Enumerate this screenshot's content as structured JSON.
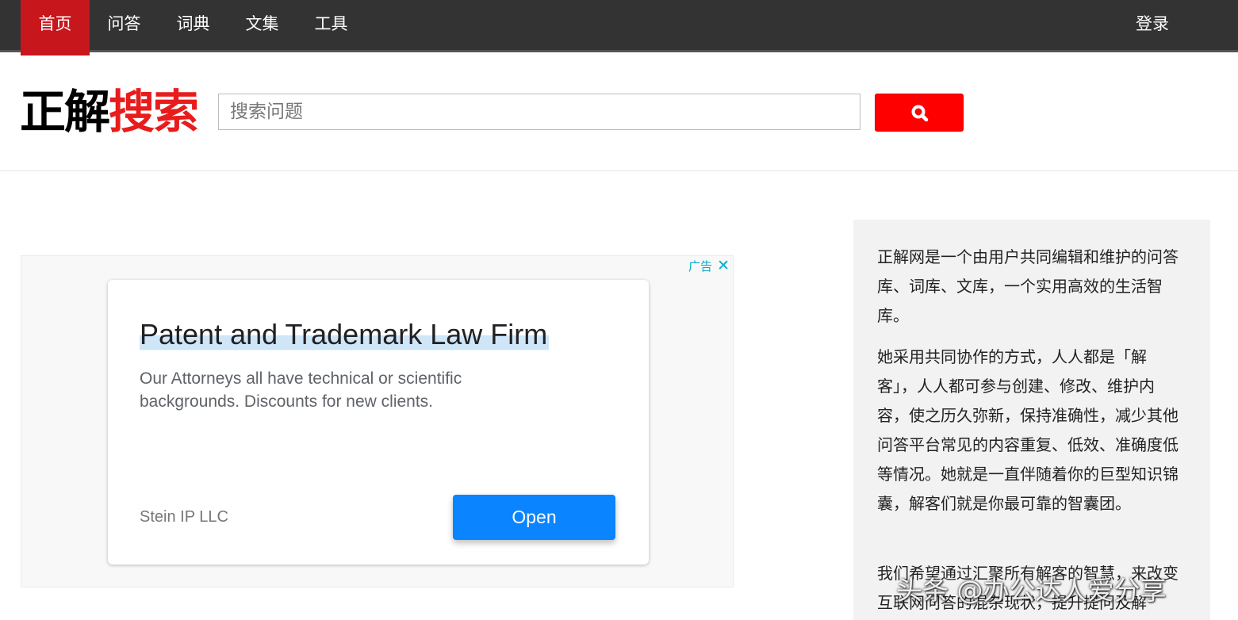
{
  "nav": {
    "items": [
      {
        "label": "首页",
        "active": true
      },
      {
        "label": "问答",
        "active": false
      },
      {
        "label": "词典",
        "active": false
      },
      {
        "label": "文集",
        "active": false
      },
      {
        "label": "工具",
        "active": false
      }
    ],
    "login_label": "登录"
  },
  "header": {
    "logo_black": "正解",
    "logo_red": "搜索",
    "search_placeholder": "搜索问题",
    "search_icon": "search-icon"
  },
  "ad": {
    "label": "广告",
    "close_glyph": "✕",
    "title": "Patent and Trademark Law Firm",
    "description": "Our Attorneys all have technical or scientific backgrounds. Discounts for new clients.",
    "advertiser": "Stein IP LLC",
    "cta": "Open"
  },
  "sidebar": {
    "paragraphs": [
      "正解网是一个由用户共同编辑和维护的问答库、词库、文库，一个实用高效的生活智库。",
      "她采用共同协作的方式，人人都是「解客」，人人都可参与创建、修改、维护内容，使之历久弥新，保持准确性，减少其他问答平台常见的内容重复、低效、准确度低等情况。她就是一直伴随着你的巨型知识锦囊，解客们就是你最可靠的智囊团。",
      "我们希望通过汇聚所有解客的智慧，来改变互联网问答的混杂现状，提升提问及解"
    ]
  },
  "watermark": "头条 @办公达人爱分享",
  "colors": {
    "nav_bg": "#333333",
    "nav_active": "#c8161d",
    "brand_red": "#e81c1c",
    "search_button": "#ff0000",
    "ad_cta": "#0a84ff",
    "sidebar_bg": "#f2f2f2"
  }
}
